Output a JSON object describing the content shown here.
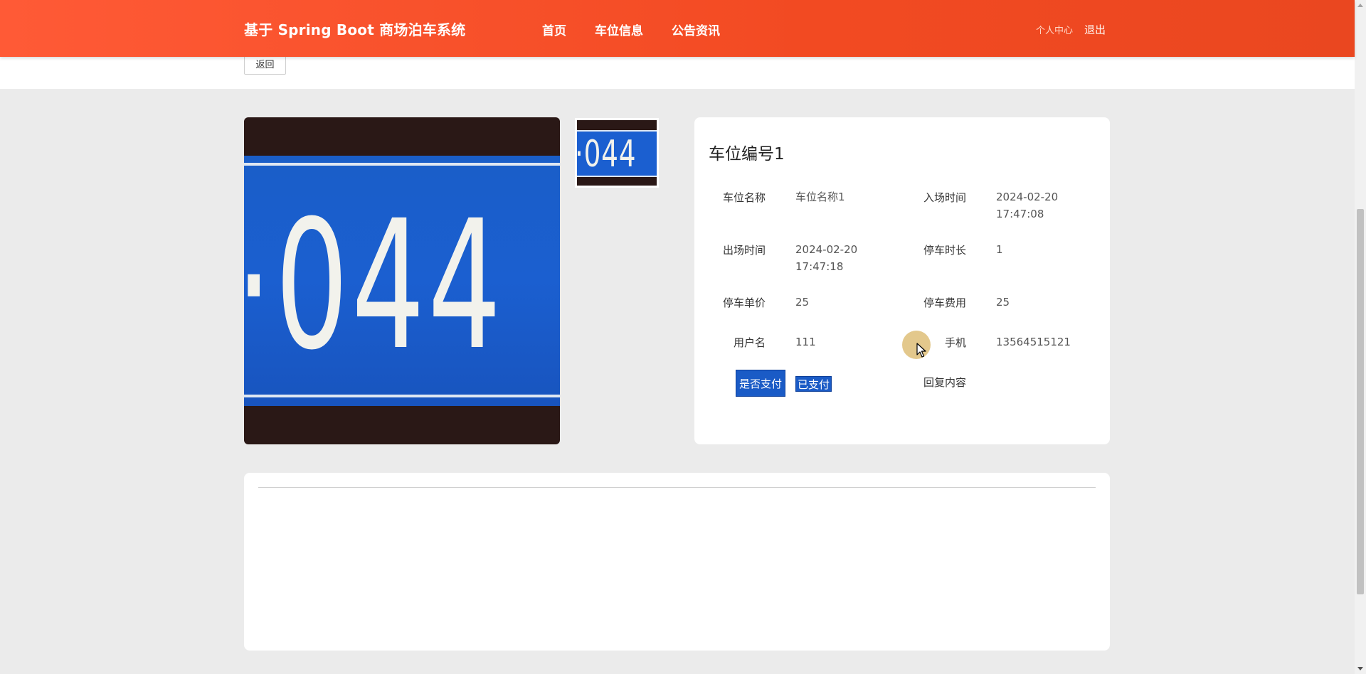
{
  "header": {
    "brand": "基于 Spring Boot 商场泊车系统",
    "nav": [
      "首页",
      "车位信息",
      "公告资讯"
    ],
    "user_center": "个人中心",
    "logout": "退出"
  },
  "back_button": "返回",
  "gallery": {
    "main_plate_text": "·044",
    "thumb_plate_text": "·044"
  },
  "detail": {
    "title": "车位编号1",
    "fields": {
      "space_name": {
        "label": "车位名称",
        "value": "车位名称1"
      },
      "entry_time": {
        "label": "入场时间",
        "value": "2024-02-20 17:47:08"
      },
      "exit_time": {
        "label": "出场时间",
        "value": "2024-02-20 17:47:18"
      },
      "duration": {
        "label": "停车时长",
        "value": "1"
      },
      "unit_price": {
        "label": "停车单价",
        "value": "25"
      },
      "fee": {
        "label": "停车费用",
        "value": "25"
      },
      "username": {
        "label": "用户名",
        "value": "111"
      },
      "phone": {
        "label": "手机",
        "value": "13564515121"
      },
      "paid": {
        "label": "是否支付",
        "value": "已支付"
      },
      "reply": {
        "label": "回复内容",
        "value": ""
      }
    }
  },
  "colors": {
    "header_start": "#ff5a36",
    "header_end": "#ea4720",
    "selection_blue": "#1a5bc6"
  }
}
